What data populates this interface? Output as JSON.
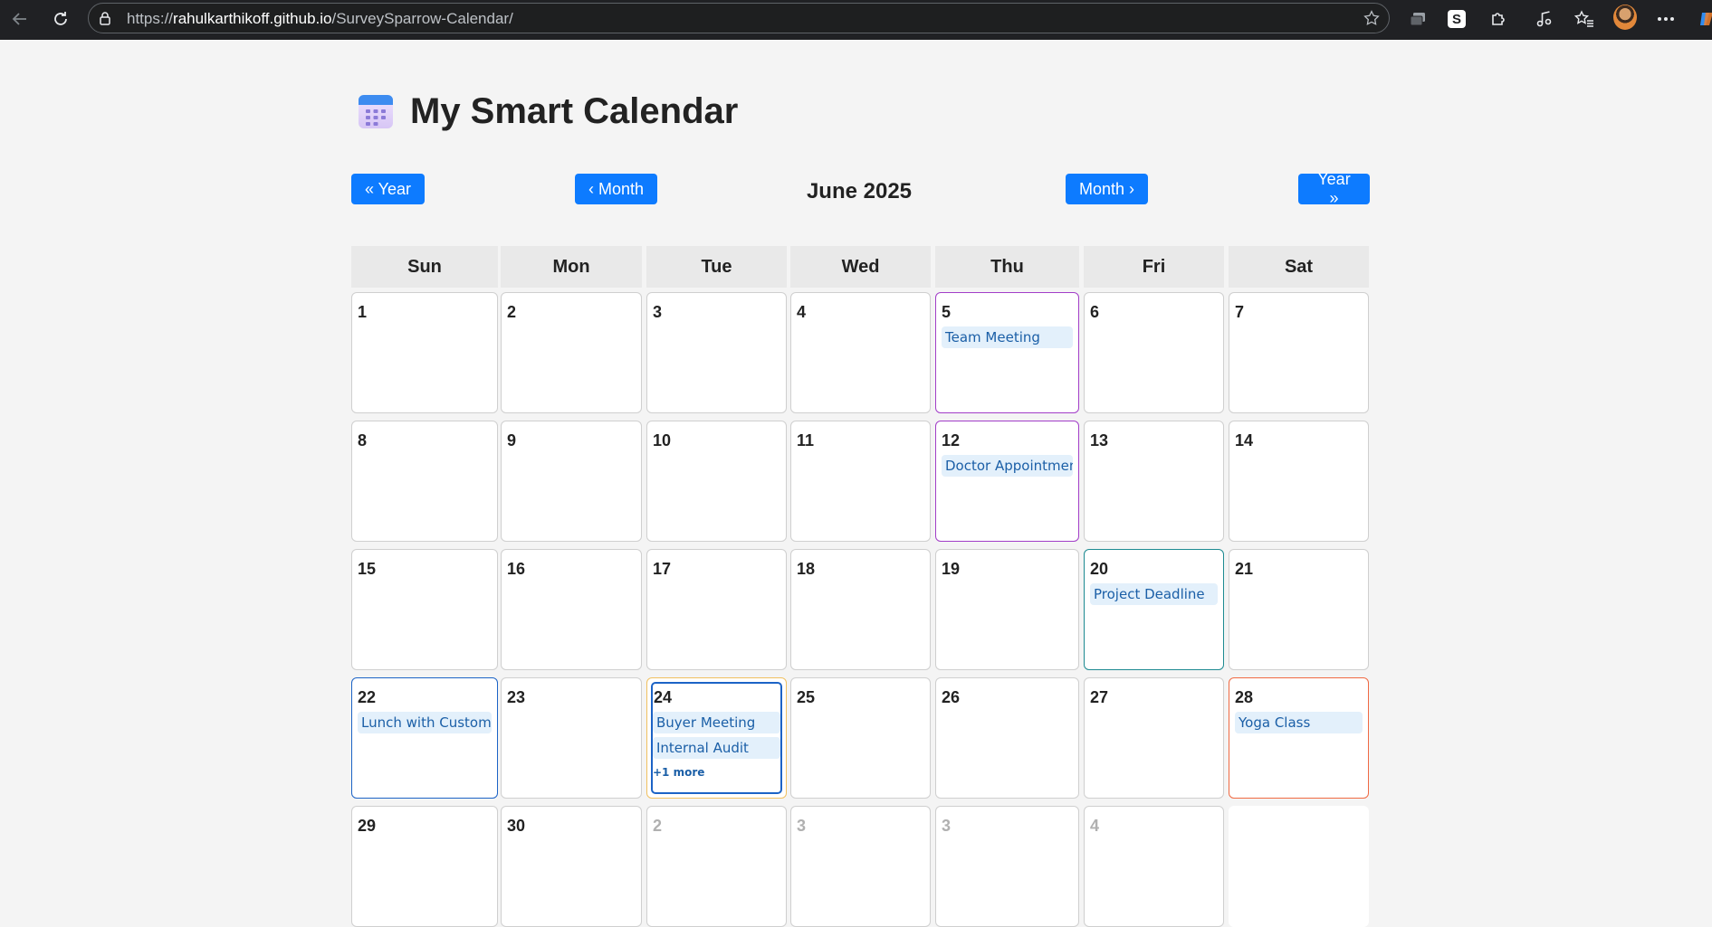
{
  "browser": {
    "url_prefix": "https://",
    "url_host": "rahulkarthikoff.github.io",
    "url_path": "/SurveySparrow-Calendar/",
    "extension_s_label": "S"
  },
  "app": {
    "title": "My Smart Calendar",
    "month_label": "June 2025",
    "nav": {
      "prev_year": "« Year",
      "prev_month": "‹ Month",
      "next_month": "Month ›",
      "next_year": "Year »"
    }
  },
  "weekdays": [
    "Sun",
    "Mon",
    "Tue",
    "Wed",
    "Thu",
    "Fri",
    "Sat"
  ],
  "colors": {
    "accent": "#0d7bff",
    "event_bg": "#e3f0fb",
    "event_text": "#1b5fa7",
    "purple_border": "#a23ec8",
    "teal_border": "#1d8a91",
    "blue_border": "#1c63c6",
    "orange_border": "#f06a43",
    "gold_border": "#f0c060"
  },
  "weeks": [
    [
      {
        "day": "1",
        "events": []
      },
      {
        "day": "2",
        "events": []
      },
      {
        "day": "3",
        "events": []
      },
      {
        "day": "4",
        "events": []
      },
      {
        "day": "5",
        "border": "purple",
        "events": [
          "Team Meeting"
        ]
      },
      {
        "day": "6",
        "events": []
      },
      {
        "day": "7",
        "events": []
      }
    ],
    [
      {
        "day": "8",
        "events": []
      },
      {
        "day": "9",
        "events": []
      },
      {
        "day": "10",
        "events": []
      },
      {
        "day": "11",
        "events": []
      },
      {
        "day": "12",
        "border": "purple",
        "events": [
          "Doctor Appointment"
        ]
      },
      {
        "day": "13",
        "events": []
      },
      {
        "day": "14",
        "events": []
      }
    ],
    [
      {
        "day": "15",
        "events": []
      },
      {
        "day": "16",
        "events": []
      },
      {
        "day": "17",
        "events": []
      },
      {
        "day": "18",
        "events": []
      },
      {
        "day": "19",
        "events": []
      },
      {
        "day": "20",
        "border": "teal",
        "events": [
          "Project Deadline"
        ]
      },
      {
        "day": "21",
        "events": []
      }
    ],
    [
      {
        "day": "22",
        "border": "blue",
        "events": [
          "Lunch with Customer"
        ]
      },
      {
        "day": "23",
        "events": []
      },
      {
        "day": "24",
        "border": "gold",
        "today": true,
        "events": [
          "Buyer Meeting",
          "Internal Audit"
        ],
        "more": "+1 more"
      },
      {
        "day": "25",
        "events": []
      },
      {
        "day": "26",
        "events": []
      },
      {
        "day": "27",
        "events": []
      },
      {
        "day": "28",
        "border": "orange",
        "events": [
          "Yoga Class"
        ]
      }
    ],
    [
      {
        "day": "29",
        "events": []
      },
      {
        "day": "30",
        "events": []
      },
      {
        "day": "2",
        "other": true,
        "events": []
      },
      {
        "day": "3",
        "other": true,
        "events": []
      },
      {
        "day": "3",
        "other": true,
        "events": []
      },
      {
        "day": "4",
        "other": true,
        "events": []
      },
      {
        "day": "",
        "blank": true,
        "events": []
      }
    ]
  ]
}
